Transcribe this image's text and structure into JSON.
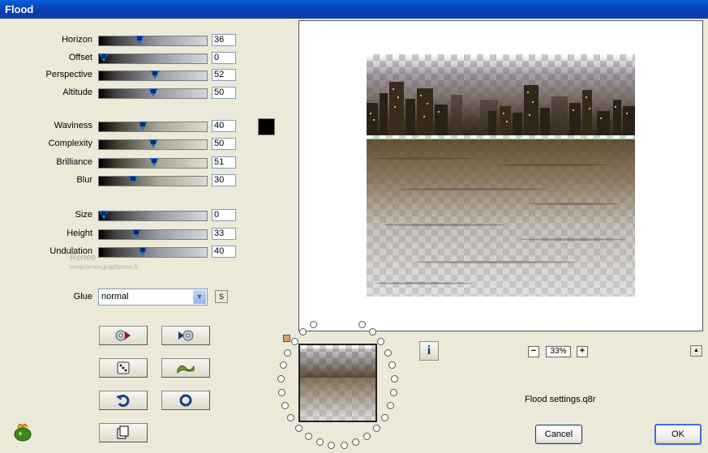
{
  "window": {
    "title": "Flood"
  },
  "sliders": [
    {
      "key": "horizon",
      "label": "Horizon",
      "value": "36",
      "pct": 0.36
    },
    {
      "key": "offset",
      "label": "Offset",
      "value": "0",
      "pct": 0
    },
    {
      "key": "perspective",
      "label": "Perspective",
      "value": "52",
      "pct": 0.52
    },
    {
      "key": "altitude",
      "label": "Altitude",
      "value": "50",
      "pct": 0.5
    },
    {
      "key": "waviness",
      "label": "Waviness",
      "value": "40",
      "pct": 0.4
    },
    {
      "key": "complexity",
      "label": "Complexity",
      "value": "50",
      "pct": 0.5
    },
    {
      "key": "brilliance",
      "label": "Brilliance",
      "value": "51",
      "pct": 0.51
    },
    {
      "key": "blur",
      "label": "Blur",
      "value": "30",
      "pct": 0.3
    },
    {
      "key": "size",
      "label": "Size",
      "value": "0",
      "pct": 0
    },
    {
      "key": "height",
      "label": "Height",
      "value": "33",
      "pct": 0.33
    },
    {
      "key": "undulation",
      "label": "Undulation",
      "value": "40",
      "pct": 0.4
    }
  ],
  "color_swatch": "#000000",
  "glue": {
    "label": "Glue",
    "value": "normal",
    "s_button": "S"
  },
  "toolbar_icons": [
    "load-settings-icon",
    "save-settings-icon",
    "random-dice-icon",
    "wave-reset-icon",
    "undo-icon",
    "circle-icon",
    "copy-icon"
  ],
  "watermark": {
    "line1": "Renee",
    "line2": "www.reneegraphisme.fr"
  },
  "zoom": {
    "minus": "−",
    "value": "33%",
    "plus": "+"
  },
  "status_text": "Flood settings.q8r",
  "buttons": {
    "cancel": "Cancel",
    "ok": "OK"
  },
  "info_label": "i",
  "up_arrow": "▲",
  "colors": {
    "title_bar": "#0841b8",
    "thumb": "#1e6fd0",
    "face": "#ece9d8"
  }
}
